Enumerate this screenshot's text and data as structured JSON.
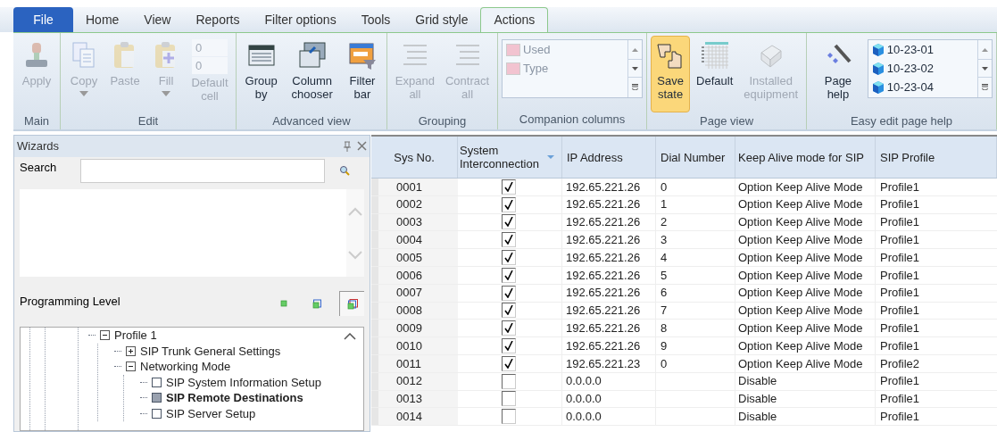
{
  "tabs": [
    {
      "label": "File",
      "kind": "file",
      "selected": false
    },
    {
      "label": "Home",
      "kind": "tab",
      "selected": false
    },
    {
      "label": "View",
      "kind": "tab",
      "selected": false
    },
    {
      "label": "Reports",
      "kind": "tab",
      "selected": false
    },
    {
      "label": "Filter options",
      "kind": "tab",
      "selected": false
    },
    {
      "label": "Tools",
      "kind": "tab",
      "selected": false
    },
    {
      "label": "Grid style",
      "kind": "tab",
      "selected": false
    },
    {
      "label": "Actions",
      "kind": "tab",
      "selected": true
    }
  ],
  "ribbon": [
    {
      "label": "Main",
      "items": [
        {
          "kind": "button",
          "label": "Apply",
          "disabled": true,
          "selected": false
        }
      ]
    },
    {
      "label": "Edit",
      "items": [
        {
          "kind": "button",
          "label": "Copy",
          "disabled": true,
          "selected": false,
          "dropdown": true
        },
        {
          "kind": "button",
          "label": "Paste",
          "disabled": true,
          "selected": false
        },
        {
          "kind": "button",
          "label": "Fill",
          "disabled": true,
          "selected": false,
          "dropdown": true
        },
        {
          "kind": "field",
          "values": [
            "0",
            "0"
          ],
          "label": "Default cell",
          "disabled": true
        }
      ]
    },
    {
      "label": "Advanced view",
      "items": [
        {
          "kind": "button",
          "label": "Group by",
          "disabled": false,
          "selected": false
        },
        {
          "kind": "button",
          "label": "Column chooser",
          "disabled": false,
          "selected": false
        },
        {
          "kind": "button",
          "label": "Filter bar",
          "disabled": false,
          "selected": false
        }
      ]
    },
    {
      "label": "Grouping",
      "items": [
        {
          "kind": "button",
          "label": "Expand all",
          "disabled": true,
          "selected": false
        },
        {
          "kind": "button",
          "label": "Contract all",
          "disabled": true,
          "selected": false
        }
      ]
    },
    {
      "label": "Companion columns",
      "items": [
        {
          "kind": "list",
          "entries": [
            "Used",
            "Type"
          ],
          "disabled": true
        }
      ]
    },
    {
      "label": "Page view",
      "items": [
        {
          "kind": "button",
          "label": "Save state",
          "disabled": false,
          "selected": true
        },
        {
          "kind": "button",
          "label": "Default",
          "disabled": false,
          "selected": false
        },
        {
          "kind": "button",
          "label": "Installed equipment",
          "disabled": true,
          "selected": false
        }
      ]
    },
    {
      "label": "Easy edit page help",
      "items": [
        {
          "kind": "button",
          "label": "Page help",
          "disabled": false,
          "selected": false
        },
        {
          "kind": "list",
          "entries": [
            "10-23-01",
            "10-23-02",
            "10-23-04"
          ],
          "disabled": false
        }
      ]
    }
  ],
  "wizards": {
    "title": "Wizards",
    "search_label": "Search",
    "level_label": "Programming Level",
    "levels": [
      {
        "selected": false
      },
      {
        "selected": false
      },
      {
        "selected": true
      }
    ],
    "tree": [
      {
        "label": "Profile 1",
        "expanded": true,
        "children": [
          {
            "label": "SIP Trunk General Settings",
            "expanded": false
          },
          {
            "label": "Networking Mode",
            "expanded": true,
            "children": [
              {
                "label": "SIP System Information Setup",
                "selected": false
              },
              {
                "label": "SIP Remote Destinations",
                "selected": true
              },
              {
                "label": "SIP Server Setup",
                "selected": false
              }
            ]
          }
        ]
      }
    ]
  },
  "grid": {
    "columns": [
      "Sys No.",
      "System Interconnection",
      "IP Address",
      "Dial Number",
      "Keep Alive mode for SIP",
      "SIP Profile"
    ],
    "rows": [
      {
        "sys": "0001",
        "checked": true,
        "ip": "192.65.221.26",
        "dial": "0",
        "keep": "Option Keep Alive Mode",
        "profile": "Profile1"
      },
      {
        "sys": "0002",
        "checked": true,
        "ip": "192.65.221.26",
        "dial": "1",
        "keep": "Option Keep Alive Mode",
        "profile": "Profile1"
      },
      {
        "sys": "0003",
        "checked": true,
        "ip": "192.65.221.26",
        "dial": "2",
        "keep": "Option Keep Alive Mode",
        "profile": "Profile1"
      },
      {
        "sys": "0004",
        "checked": true,
        "ip": "192.65.221.26",
        "dial": "3",
        "keep": "Option Keep Alive Mode",
        "profile": "Profile1"
      },
      {
        "sys": "0005",
        "checked": true,
        "ip": "192.65.221.26",
        "dial": "4",
        "keep": "Option Keep Alive Mode",
        "profile": "Profile1"
      },
      {
        "sys": "0006",
        "checked": true,
        "ip": "192.65.221.26",
        "dial": "5",
        "keep": "Option Keep Alive Mode",
        "profile": "Profile1"
      },
      {
        "sys": "0007",
        "checked": true,
        "ip": "192.65.221.26",
        "dial": "6",
        "keep": "Option Keep Alive Mode",
        "profile": "Profile1"
      },
      {
        "sys": "0008",
        "checked": true,
        "ip": "192.65.221.26",
        "dial": "7",
        "keep": "Option Keep Alive Mode",
        "profile": "Profile1"
      },
      {
        "sys": "0009",
        "checked": true,
        "ip": "192.65.221.26",
        "dial": "8",
        "keep": "Option Keep Alive Mode",
        "profile": "Profile1"
      },
      {
        "sys": "0010",
        "checked": true,
        "ip": "192.65.221.26",
        "dial": "9",
        "keep": "Option Keep Alive Mode",
        "profile": "Profile1"
      },
      {
        "sys": "0011",
        "checked": true,
        "ip": "192.65.221.23",
        "dial": "0",
        "keep": "Option Keep Alive Mode",
        "profile": "Profile2"
      },
      {
        "sys": "0012",
        "checked": false,
        "ip": "0.0.0.0",
        "keep": "Disable",
        "profile": "Profile1"
      },
      {
        "sys": "0013",
        "checked": false,
        "ip": "0.0.0.0",
        "keep": "Disable",
        "profile": "Profile1"
      },
      {
        "sys": "0014",
        "checked": false,
        "ip": "0.0.0.0",
        "keep": "Disable",
        "profile": "Profile1"
      }
    ]
  }
}
